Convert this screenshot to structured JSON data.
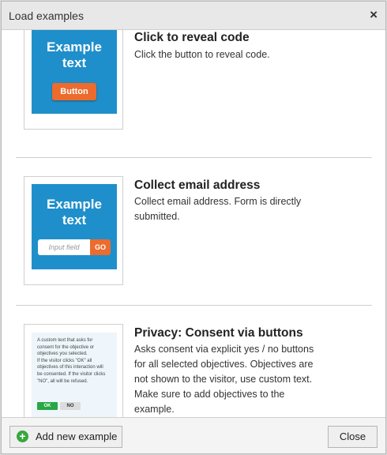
{
  "dialog": {
    "title": "Load examples",
    "close_glyph": "×"
  },
  "examples": [
    {
      "title": "Click to reveal code",
      "description": "Click the button to reveal code.",
      "thumb_text": "Example\ntext",
      "thumb_button": "Button"
    },
    {
      "title": "Collect email address",
      "description": "Collect email address. Form is directly submitted.",
      "thumb_text": "Example\ntext",
      "thumb_input_placeholder": "Input field",
      "thumb_go": "GO"
    },
    {
      "title": "Privacy: Consent via buttons",
      "description": "Asks consent via explicit yes / no buttons for all selected objectives. Objectives are not shown to the visitor, use custom text. Make sure to add objectives to the example.",
      "thumb_lines": [
        "A custom text that asks for",
        "consent for the objective or",
        "objectives you selected.",
        "If the visitor clicks \"OK\" all",
        "objectives of this interaction will",
        "be consented. If the visitor clicks",
        "\"NO\", all will be refused."
      ],
      "thumb_ok": "OK",
      "thumb_no": "NO"
    }
  ],
  "footer": {
    "add_label": "Add new example",
    "close_label": "Close"
  },
  "colors": {
    "thumb_blue": "#1f8fcb",
    "accent_orange": "#ec6b2d",
    "ok_green": "#28a744"
  }
}
